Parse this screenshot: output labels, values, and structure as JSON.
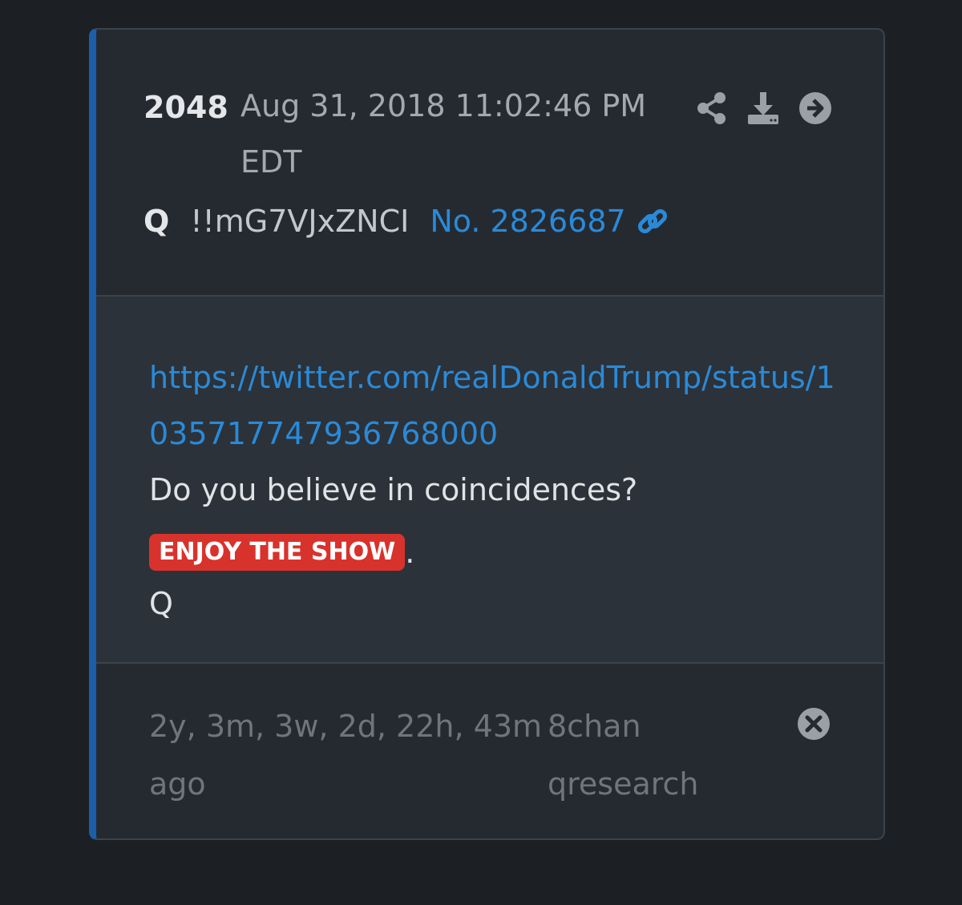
{
  "post": {
    "number": "2048",
    "timestamp": "Aug 31, 2018 11:02:46 PM EDT",
    "author": "Q",
    "tripcode": "!!mG7VJxZNCI",
    "post_link": "No. 2826687"
  },
  "content": {
    "link": "https://twitter.com/realDonaldTrump/status/1035717747936768000",
    "line1": "Do you believe in coincidences?",
    "badge": "ENJOY THE SHOW",
    "badge_suffix": ".",
    "signature": "Q"
  },
  "footer": {
    "age": "2y, 3m, 3w, 2d, 22h, 43m ago",
    "board": "8chan qresearch"
  },
  "icons": {
    "share": "share-icon",
    "download": "download-icon",
    "open": "arrow-right-circle-icon",
    "link": "link-icon",
    "close": "close-circle-icon"
  },
  "colors": {
    "accent": "#1c5ea8",
    "link": "#2a8ad8",
    "badge": "#d8322c"
  }
}
